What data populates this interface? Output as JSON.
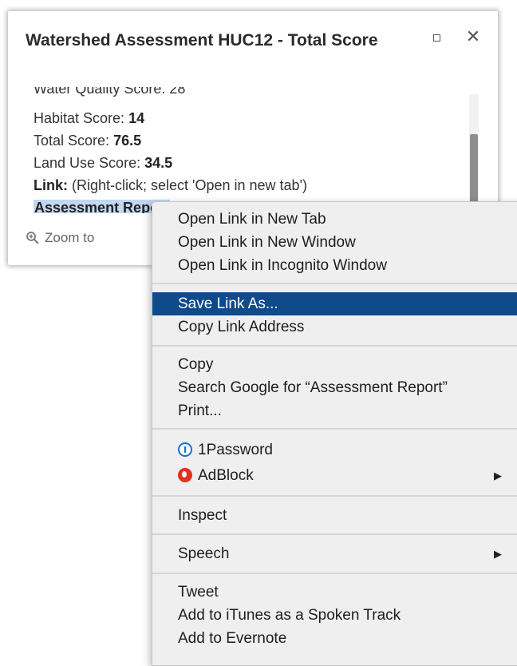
{
  "popup": {
    "title": "Watershed Assessment HUC12 - Total Score",
    "clipped_line": "Water Quality Score: 28",
    "attributes": [
      {
        "label": "Habitat Score:",
        "value": "14"
      },
      {
        "label": "Total Score:",
        "value": "76.5"
      },
      {
        "label": "Land Use Score:",
        "value": "34.5"
      }
    ],
    "link_label": "Link:",
    "link_hint": "(Right-click; select 'Open in new tab')",
    "link_text": "Assessment Report",
    "zoom_label": "Zoom to"
  },
  "context_menu": {
    "groups": [
      [
        "Open Link in New Tab",
        "Open Link in New Window",
        "Open Link in Incognito Window"
      ],
      [
        "Save Link As...",
        "Copy Link Address"
      ],
      [
        "Copy",
        "Search Google for “Assessment Report”",
        "Print..."
      ],
      [
        "1Password",
        "AdBlock"
      ],
      [
        "Inspect"
      ],
      [
        "Speech"
      ],
      [
        "Tweet",
        "Add to iTunes as a Spoken Track",
        "Add to Evernote"
      ]
    ],
    "active_item": "Save Link As...",
    "submenu_arrow": "▶",
    "accent_color": "#0f4a8a"
  }
}
